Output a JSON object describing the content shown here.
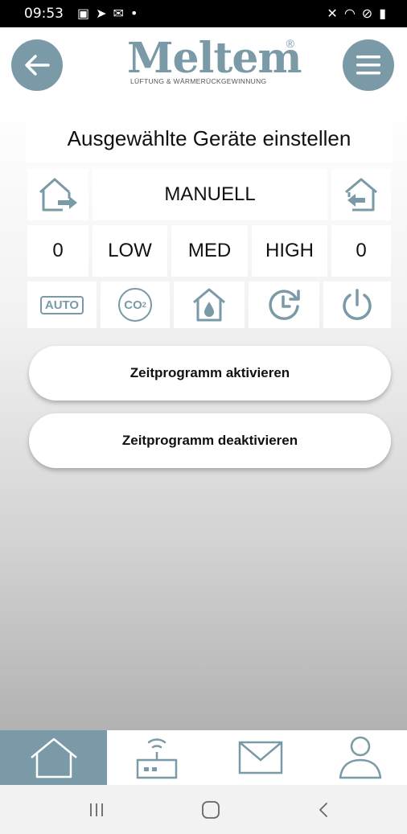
{
  "status_bar": {
    "time": "09:53",
    "left_icons": [
      "gallery-icon",
      "cast-icon",
      "mail-icon",
      "dot-icon"
    ],
    "right_icons": [
      "mute-icon",
      "wifi-icon",
      "dnd-icon",
      "battery-icon"
    ]
  },
  "header": {
    "logo_text": "Meltem",
    "logo_registered": "®",
    "logo_tagline": "LÜFTUNG & WÄRMERÜCKGEWINNUNG"
  },
  "panel": {
    "title": "Ausgewählte Geräte einstellen",
    "mode": "MANUELL",
    "left_value": "0",
    "right_value": "0",
    "levels": [
      "LOW",
      "MED",
      "HIGH"
    ],
    "auto_label": "AUTO",
    "co2_label": "CO",
    "co2_sub": "2"
  },
  "buttons": {
    "activate": "Zeitprogramm aktivieren",
    "deactivate": "Zeitprogramm deaktivieren"
  },
  "bottom_nav": {
    "active_tab": "home",
    "tabs": [
      "home-icon",
      "router-icon",
      "mail-icon",
      "user-icon"
    ]
  },
  "colors": {
    "accent": "#7a9aa7",
    "status_bar": "#000000"
  }
}
